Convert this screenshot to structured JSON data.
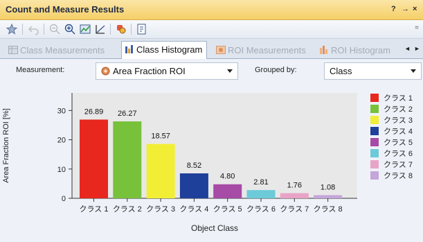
{
  "window": {
    "title": "Count and Measure Results",
    "controls": {
      "help": "?",
      "pin": "→",
      "close": "×"
    }
  },
  "toolbar": {
    "buttons": [
      {
        "icon": "star-icon",
        "enabled": true
      },
      {
        "icon": "undo-icon",
        "enabled": false
      },
      {
        "icon": "zoom-out-icon",
        "enabled": false
      },
      {
        "icon": "zoom-in-icon",
        "enabled": true
      },
      {
        "icon": "chart-grid-icon",
        "enabled": true
      },
      {
        "icon": "draw-line-icon",
        "enabled": true
      },
      {
        "icon": "measure-tool-icon",
        "enabled": true
      },
      {
        "icon": "export-icon",
        "enabled": true
      }
    ],
    "overflow": "="
  },
  "tabs": [
    {
      "label": "Class Measurements",
      "icon": "table-icon",
      "active": false
    },
    {
      "label": "Class Histogram",
      "icon": "histogram-icon",
      "active": true
    },
    {
      "label": "ROI Measurements",
      "icon": "roi-table-icon",
      "active": false
    },
    {
      "label": "ROI Histogram",
      "icon": "roi-histogram-icon",
      "active": false
    }
  ],
  "tab_nav": {
    "prev": "◄",
    "next": "►"
  },
  "measurement": {
    "label": "Measurement:",
    "value": "Area Fraction ROI"
  },
  "grouped_by": {
    "label": "Grouped by:",
    "value": "Class"
  },
  "colors": {
    "accent_title": "#f5cf68",
    "chart_bg": "#e8e8e8"
  },
  "chart_data": {
    "type": "bar",
    "categories": [
      "クラス 1",
      "クラス 2",
      "クラス 3",
      "クラス 4",
      "クラス 5",
      "クラス 6",
      "クラス 7",
      "クラス 8"
    ],
    "values": [
      26.89,
      26.27,
      18.57,
      8.52,
      4.8,
      2.81,
      1.76,
      1.08
    ],
    "value_labels": [
      "26.89",
      "26.27",
      "18.57",
      "8.52",
      "4.80",
      "2.81",
      "1.76",
      "1.08"
    ],
    "colors": [
      "#e8271e",
      "#78c13b",
      "#f2ee35",
      "#1e3f9a",
      "#a64ba6",
      "#6ccad9",
      "#e8a4c6",
      "#c4a6d9"
    ],
    "yticks": [
      "0",
      "10",
      "20",
      "30"
    ],
    "ylim": [
      0,
      36
    ],
    "xlabel": "Object Class",
    "ylabel": "Area Fraction ROI [%]",
    "legend": [
      "クラス 1",
      "クラス 2",
      "クラス 3",
      "クラス 4",
      "クラス 5",
      "クラス 6",
      "クラス 7",
      "クラス 8"
    ],
    "legend_position": "right",
    "grid": false
  }
}
